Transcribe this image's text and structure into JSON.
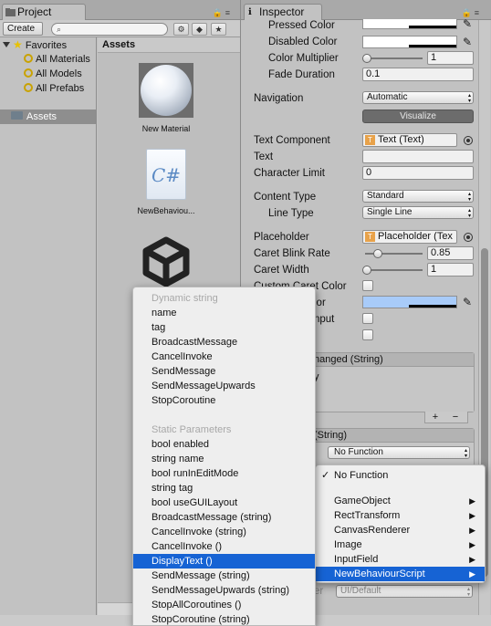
{
  "project": {
    "tab_label": "Project",
    "create_label": "Create ▾",
    "assets_header": "Assets",
    "tree": {
      "favorites": "Favorites",
      "items": [
        "All Materials",
        "All Models",
        "All Prefabs"
      ],
      "assets": "Assets"
    },
    "assets_grid": [
      {
        "name": "New Material"
      },
      {
        "name": "NewBehaviou..."
      }
    ]
  },
  "inspector": {
    "tab_label": "Inspector",
    "labels": {
      "pressed_color": "Pressed Color",
      "disabled_color": "Disabled Color",
      "color_multiplier": "Color Multiplier",
      "fade_duration": "Fade Duration",
      "navigation": "Navigation",
      "text_component": "Text Component",
      "text": "Text",
      "character_limit": "Character Limit",
      "content_type": "Content Type",
      "line_type": "Line Type",
      "placeholder": "Placeholder",
      "caret_blink_rate": "Caret Blink Rate",
      "caret_width": "Caret Width",
      "custom_caret_color": "Custom Caret Color",
      "selection_color_tail": "lor",
      "hide_mobile_input_tail": "nput"
    },
    "values": {
      "color_multiplier": "1",
      "fade_duration": "0.1",
      "navigation": "Automatic",
      "visualize": "Visualize",
      "text_component": "Text (Text)",
      "text": "",
      "character_limit": "0",
      "content_type": "Standard",
      "line_type": "Single Line",
      "placeholder": "Placeholder (Tex",
      "caret_blink_rate": "0.85",
      "caret_width": "1"
    },
    "slider_levels": {
      "color_multiplier": 0.0,
      "caret_blink_rate": 0.2,
      "caret_width": 0.0
    },
    "on_value_changed_tail": "nanged (String)",
    "on_value_changed_body_tail": "y",
    "on_end_edit_tail": "(String)",
    "function_popup": "No Function",
    "material_popup": "UI/Default",
    "material_label_tail": "er"
  },
  "function_menu": {
    "no_function": "No Function",
    "items": [
      "GameObject",
      "RectTransform",
      "CanvasRenderer",
      "Image",
      "InputField",
      "NewBehaviourScript"
    ],
    "selected": "NewBehaviourScript"
  },
  "method_menu": {
    "dynamic_header": "Dynamic string",
    "dynamic_items": [
      "name",
      "tag",
      "BroadcastMessage",
      "CancelInvoke",
      "SendMessage",
      "SendMessageUpwards",
      "StopCoroutine"
    ],
    "static_header": "Static Parameters",
    "static_items": [
      "bool enabled",
      "string name",
      "bool runInEditMode",
      "string tag",
      "bool useGUILayout",
      "BroadcastMessage (string)",
      "CancelInvoke (string)",
      "CancelInvoke ()",
      "DisplayText ()",
      "SendMessage (string)",
      "SendMessageUpwards (string)",
      "StopAllCoroutines ()",
      "StopCoroutine (string)"
    ],
    "selected": "DisplayText ()"
  },
  "colors": {
    "menu_selection": "#1663d4",
    "selection_color_swatch": "#a8cbf9"
  }
}
